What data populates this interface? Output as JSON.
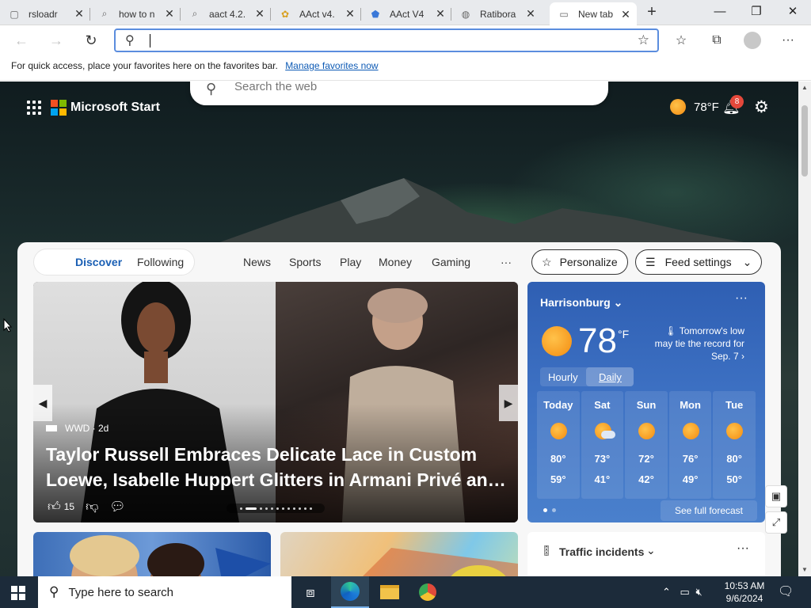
{
  "tabs": [
    {
      "label": "rsloadr",
      "icon": "page-icon"
    },
    {
      "label": "how to n",
      "icon": "search-icon"
    },
    {
      "label": "aact 4.2.",
      "icon": "search-icon"
    },
    {
      "label": "AAct v4.",
      "icon": "aact-icon"
    },
    {
      "label": "AAct V4",
      "icon": "app-icon"
    },
    {
      "label": "Ratibora",
      "icon": "globe-icon"
    },
    {
      "label": "New tab",
      "icon": "newtab-icon"
    }
  ],
  "window_controls": {
    "minimize": "—",
    "restore": "❐",
    "close": "✕"
  },
  "address_bar": {
    "value": "",
    "placeholder": ""
  },
  "favorites_bar": {
    "text": "For quick access, place your favorites here on the favorites bar.",
    "link": "Manage favorites now"
  },
  "ntp": {
    "search_placeholder": "Search the web",
    "brand": "Microsoft Start",
    "top_temp": "78°F",
    "notification_count": "8",
    "feed_tabs": {
      "discover": "Discover",
      "following": "Following"
    },
    "categories": [
      "News",
      "Sports",
      "Play",
      "Money",
      "Gaming",
      "···"
    ],
    "personalize": "Personalize",
    "feed_settings": "Feed settings"
  },
  "hero": {
    "source": "WWD · 2d",
    "headline": "Taylor Russell Embraces Delicate Lace in Custom Loewe, Isabelle Huppert Glitters in Armani Privé an…",
    "likes": "15"
  },
  "weather": {
    "city": "Harrisonburg",
    "temp": "78",
    "unit": "°F",
    "note": "Tomorrow's low may tie the record for Sep. 7",
    "tab_hourly": "Hourly",
    "tab_daily": "Daily",
    "days": [
      {
        "name": "Today",
        "hi": "80°",
        "lo": "59°",
        "icon": "sunny"
      },
      {
        "name": "Sat",
        "hi": "73°",
        "lo": "41°",
        "icon": "partly-cloudy"
      },
      {
        "name": "Sun",
        "hi": "72°",
        "lo": "42°",
        "icon": "sunny"
      },
      {
        "name": "Mon",
        "hi": "76°",
        "lo": "49°",
        "icon": "sunny"
      },
      {
        "name": "Tue",
        "hi": "80°",
        "lo": "50°",
        "icon": "sunny"
      }
    ],
    "see_forecast": "See full forecast"
  },
  "traffic": {
    "title": "Traffic incidents"
  },
  "taskbar": {
    "search_placeholder": "Type here to search",
    "time": "10:53 AM",
    "date": "9/6/2024"
  },
  "colors": {
    "accent": "#0e5bb5",
    "weather_card": "#3e72c4",
    "taskbar": "#1c2b3a"
  }
}
